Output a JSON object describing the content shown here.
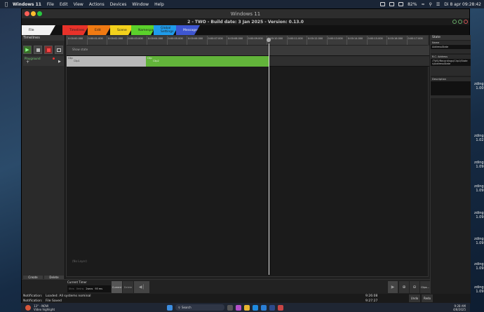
{
  "mac": {
    "app": "Windows 11",
    "menus": [
      "File",
      "Edit",
      "View",
      "Actions",
      "Devices",
      "Window",
      "Help"
    ],
    "battery": "82%",
    "datetime": "Di 8 apr  09:28:42"
  },
  "side_texts": [
    "zding\n1.00",
    "zding\n1.02",
    "zding\n1.09",
    "zding\n1.09",
    "zding\n1.09",
    "zding\n1.09",
    "zding\n1.09",
    "zding\n1.09"
  ],
  "vm": {
    "title": "Windows 11",
    "app_title": "2 - TWO - Build date: 3 Jan 2025 - Version: 0.13.0"
  },
  "tabs": [
    {
      "label": "File",
      "color": "#f2f2f2"
    },
    {
      "label": "Timelines",
      "color": "#e8322a"
    },
    {
      "label": "Edit",
      "color": "#f07a12"
    },
    {
      "label": "Scene",
      "color": "#f3d11c"
    },
    {
      "label": "Namespaces",
      "color": "#5bd12b"
    },
    {
      "label": "Global Settings",
      "color": "#1f9bea"
    },
    {
      "label": "Messages",
      "color": "#3e56d0"
    }
  ],
  "left_panel": {
    "title": "Timelines",
    "timeline_name": "Playground",
    "create_label": "Create",
    "delete_label": "Delete",
    "speed_label": "Speed",
    "multiplier_label": "Multiplier",
    "multiplier_value": "1.000"
  },
  "timeline": {
    "ruler_ticks": [
      "0:00:00.000",
      "0:00:01.000",
      "0:00:02.000",
      "0:00:03.000",
      "0:00:04.000",
      "0:00:05.000",
      "0:00:06.000",
      "0:00:07.000",
      "0:00:08.000",
      "0:00:09.000",
      "0:00:10.000",
      "0:00:11.000",
      "0:00:12.000",
      "0:00:13.000",
      "0:00:14.000",
      "0:00:15.000",
      "0:00:16.000",
      "0:00:17.000"
    ],
    "track1_label": "Show state",
    "clip1_title": "Clip",
    "clip1_name": "Clip1",
    "clip2_title": "Clip",
    "clip2_name": "Clip2",
    "empty_label": "(No Layer)"
  },
  "bottom": {
    "current_timer_label": "Current Timer",
    "time_parts": [
      "0hrs",
      "0mins",
      "2secs",
      "93 ms"
    ],
    "current_btn": "Current",
    "delete_btn": "Delete",
    "clips_btn": "Clips..."
  },
  "status": {
    "notif1_label": "Notification:",
    "notif1_text": "Loaded:  All systems nominal",
    "notif1_time": "9:26:08",
    "notif2_label": "Notification:",
    "notif2_text": "File Saved",
    "notif2_time": "9:27:27",
    "undo": "Undo",
    "redo": "Redo"
  },
  "right_panel": {
    "state_head": "State",
    "name_head": "Name",
    "name_value": "AddressState",
    "address_head": "R.C. Address",
    "address_value": "/TWO/Recordings/Clip1/States/AddressState",
    "description_head": "Description"
  },
  "taskbar": {
    "weather_temp": "13° - NOW",
    "weather_desc": "Video highlight",
    "search": "Search",
    "time": "9:28 AM",
    "date": "4/8/2025"
  }
}
